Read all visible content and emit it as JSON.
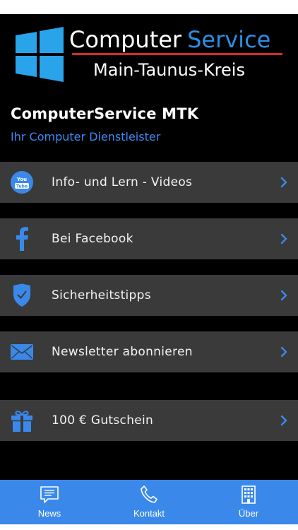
{
  "logo": {
    "line1_part1": "Computer",
    "line1_part2": "Service",
    "line2": "Main-Taunus-Kreis"
  },
  "header": {
    "title": "ComputerService MTK",
    "subtitle": "Ihr Computer Dienstleister"
  },
  "menu": [
    {
      "label": "Info- und Lern - Videos",
      "icon": "youtube-icon",
      "icon_text_top": "You",
      "icon_text_bottom": "Tube"
    },
    {
      "label": "Bei Facebook",
      "icon": "facebook-icon"
    },
    {
      "label": "Sicherheitstipps",
      "icon": "shield-check-icon"
    },
    {
      "label": "Newsletter abonnieren",
      "icon": "envelope-icon"
    },
    {
      "label": "100 € Gutschein",
      "icon": "gift-icon"
    }
  ],
  "tabbar": [
    {
      "label": "News",
      "icon": "news-icon"
    },
    {
      "label": "Kontakt",
      "icon": "phone-icon"
    },
    {
      "label": "Über",
      "icon": "building-icon"
    }
  ],
  "colors": {
    "accent": "#3a89ea",
    "row_background": "#3a3a3a",
    "background": "#000000",
    "subtitle": "#3d8bf2"
  }
}
